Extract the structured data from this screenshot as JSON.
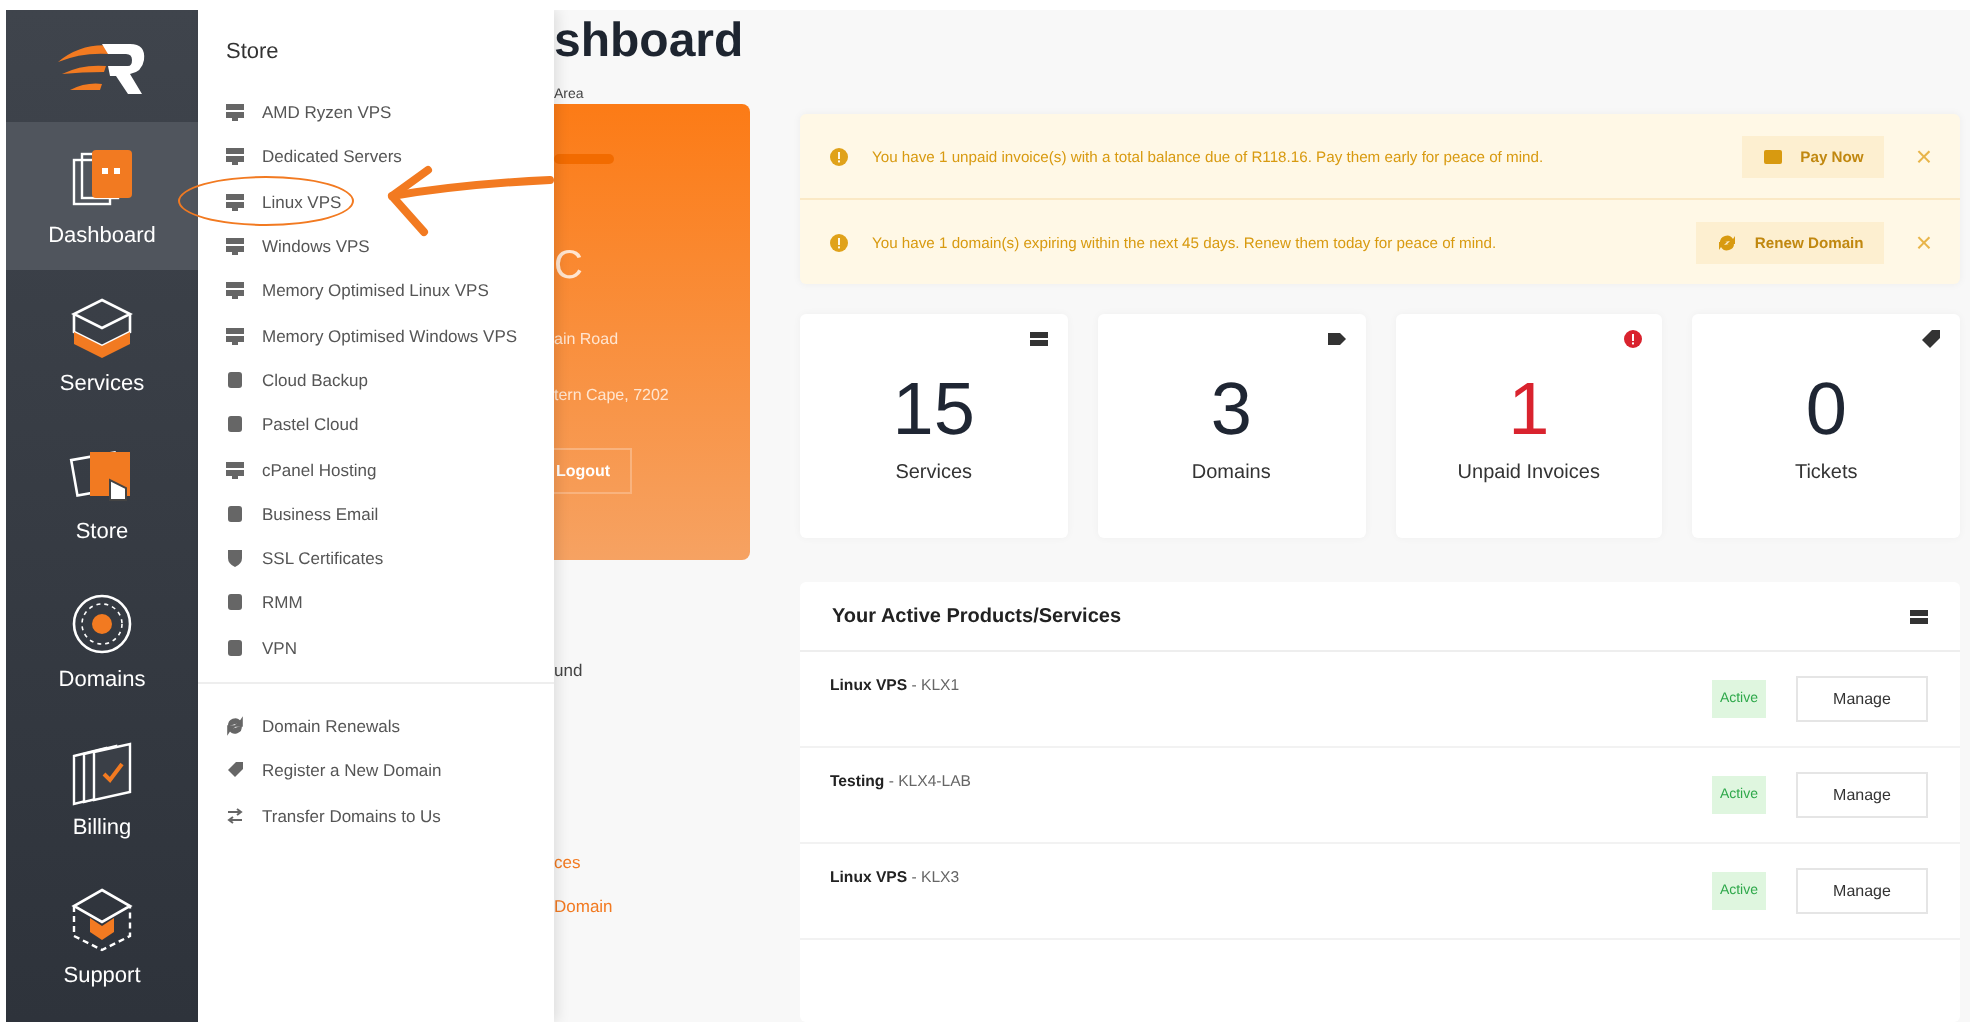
{
  "sidebar": {
    "items": [
      {
        "label": "Dashboard",
        "kind": "dashboard",
        "selected": true
      },
      {
        "label": "Services",
        "kind": "services",
        "selected": false
      },
      {
        "label": "Store",
        "kind": "store",
        "selected": false
      },
      {
        "label": "Domains",
        "kind": "domains",
        "selected": false
      },
      {
        "label": "Billing",
        "kind": "billing",
        "selected": false
      },
      {
        "label": "Support",
        "kind": "support",
        "selected": false
      }
    ]
  },
  "store_menu": {
    "title": "Store",
    "groups": [
      [
        {
          "label": "AMD Ryzen VPS",
          "kind": "server",
          "circled": false
        },
        {
          "label": "Dedicated Servers",
          "kind": "server",
          "circled": false
        },
        {
          "label": "Linux VPS",
          "kind": "server",
          "circled": true
        },
        {
          "label": "Windows VPS",
          "kind": "server",
          "circled": false
        },
        {
          "label": "Memory Optimised Linux VPS",
          "kind": "server",
          "circled": false
        },
        {
          "label": "Memory Optimised Windows VPS",
          "kind": "server",
          "circled": false
        },
        {
          "label": "Cloud Backup",
          "kind": "box",
          "circled": false
        },
        {
          "label": "Pastel Cloud",
          "kind": "box",
          "circled": false
        },
        {
          "label": "cPanel Hosting",
          "kind": "server",
          "circled": false
        },
        {
          "label": "Business Email",
          "kind": "box",
          "circled": false
        },
        {
          "label": "SSL Certificates",
          "kind": "shield",
          "circled": false
        },
        {
          "label": "RMM",
          "kind": "box",
          "circled": false
        },
        {
          "label": "VPN",
          "kind": "box",
          "circled": false
        }
      ],
      [
        {
          "label": "Domain Renewals",
          "kind": "sync",
          "circled": false
        },
        {
          "label": "Register a New Domain",
          "kind": "tag",
          "circled": false
        },
        {
          "label": "Transfer Domains to Us",
          "kind": "transfer",
          "circled": false
        }
      ]
    ]
  },
  "page": {
    "title": "shboard",
    "breadcrumb": "Area"
  },
  "profile_card": {
    "lines": [
      "C",
      "ain Road",
      "tern Cape, 7202"
    ],
    "button": "Logout"
  },
  "left_texts": [
    {
      "text": "und",
      "kind": "plain"
    },
    {
      "text": "ces",
      "kind": "link"
    },
    {
      "text": "Domain",
      "kind": "link"
    }
  ],
  "alerts": [
    {
      "text": "You have 1 unpaid invoice(s) with a total balance due of R118.16. Pay them early for peace of mind.",
      "button": "Pay Now",
      "kind": "invoice",
      "close": "×"
    },
    {
      "text": "You have 1 domain(s) expiring within the next 45 days. Renew them today for peace of mind.",
      "button": "Renew Domain",
      "kind": "domain",
      "close": "×"
    }
  ],
  "stats": [
    {
      "value": "15",
      "label": "Services",
      "kind": "server",
      "alert": false
    },
    {
      "value": "3",
      "label": "Domains",
      "kind": "label",
      "alert": false
    },
    {
      "value": "1",
      "label": "Unpaid Invoices",
      "kind": "exclamation",
      "alert": true
    },
    {
      "value": "0",
      "label": "Tickets",
      "kind": "tag",
      "alert": false
    }
  ],
  "products": {
    "title": "Your Active Products/Services",
    "rows": [
      {
        "name": "**Linux VPS** - KLX1",
        "status": "Active",
        "button": "Manage"
      },
      {
        "name": "**Testing** - KLX4-LAB",
        "status": "Active",
        "button": "Manage"
      },
      {
        "name": "**Linux VPS** - KLX3",
        "status": "Active",
        "button": "Manage"
      }
    ]
  }
}
